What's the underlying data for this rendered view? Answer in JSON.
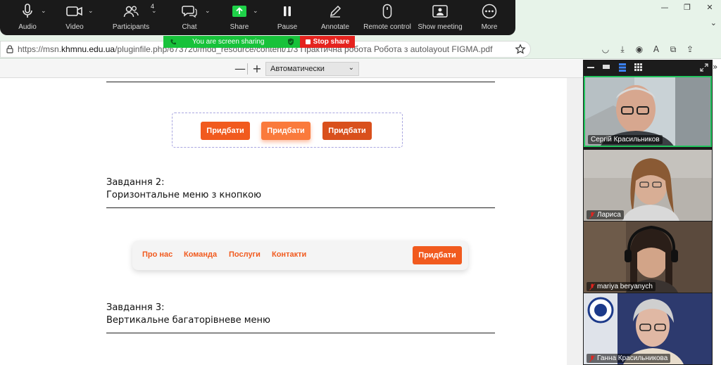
{
  "zoom_toolbar": {
    "buttons": [
      {
        "label": "Audio",
        "icon": "microphone-icon"
      },
      {
        "label": "Video",
        "icon": "video-camera-icon"
      },
      {
        "label": "Participants",
        "icon": "participants-icon",
        "count": "4"
      },
      {
        "label": "Chat",
        "icon": "chat-icon"
      },
      {
        "label": "Share",
        "icon": "share-screen-icon"
      },
      {
        "label": "Pause",
        "icon": "pause-icon"
      },
      {
        "label": "Annotate",
        "icon": "annotate-pen-icon"
      },
      {
        "label": "Remote control",
        "icon": "mouse-icon"
      },
      {
        "label": "Show meeting",
        "icon": "show-meeting-icon"
      },
      {
        "label": "More",
        "icon": "more-dots-icon"
      }
    ],
    "sharing_banner": "You are screen sharing",
    "stop_share": "Stop share"
  },
  "browser": {
    "url_prefix": "https://msn.",
    "url_domain": "khmnu.edu.ua",
    "url_path": "/pluginfile.php/673720/mod_resource/content/1/3 Практична робота Робота з autolayout FIGMA.pdf"
  },
  "pdf_toolbar": {
    "zoom_out": "—",
    "zoom_in": "+",
    "zoom_value": "Автоматически"
  },
  "pdf": {
    "demo_buttons": [
      "Придбати",
      "Придбати",
      "Придбати"
    ],
    "task2_title": "Завдання 2:",
    "task2_subtitle": "Горизонтальне меню з кнопкою",
    "menu": {
      "links": [
        "Про нас",
        "Команда",
        "Послуги",
        "Контакти"
      ],
      "cta": "Придбати"
    },
    "task3_title": "Завдання 3:",
    "task3_subtitle": "Вертикальне багаторівневе меню"
  },
  "video_panel": {
    "participants": [
      {
        "name": "Сергій Красильников",
        "muted": false,
        "active": true
      },
      {
        "name": "Лариса",
        "muted": true,
        "active": false
      },
      {
        "name": "mariya beryanych",
        "muted": true,
        "active": false
      },
      {
        "name": "Ганна Красильникова",
        "muted": true,
        "active": false
      }
    ]
  },
  "colors": {
    "accent_orange": "#f15a1e",
    "share_green": "#17c23a",
    "stop_red": "#e5231e",
    "speaker_border": "#22c55e"
  }
}
